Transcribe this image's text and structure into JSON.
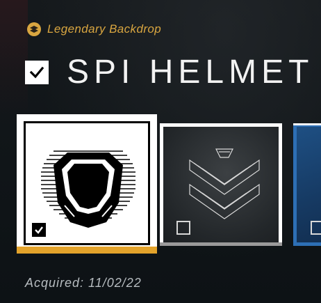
{
  "rarity": {
    "label": "Legendary Backdrop",
    "icon": "legendary-rarity-icon",
    "color": "#e3a32b"
  },
  "item": {
    "name": "SPI HELMET",
    "equipped": true
  },
  "tiles": [
    {
      "name": "spi-helmet-emblem",
      "selected": true,
      "checked": true,
      "accent": "#e3a32b"
    },
    {
      "name": "chevron-emblem",
      "selected": false,
      "checked": false,
      "accent": "#9a9a9a"
    },
    {
      "name": "blue-backdrop",
      "selected": false,
      "checked": false,
      "accent": "#2d6fb5"
    }
  ],
  "acquired": "Acquired: 11/02/22"
}
